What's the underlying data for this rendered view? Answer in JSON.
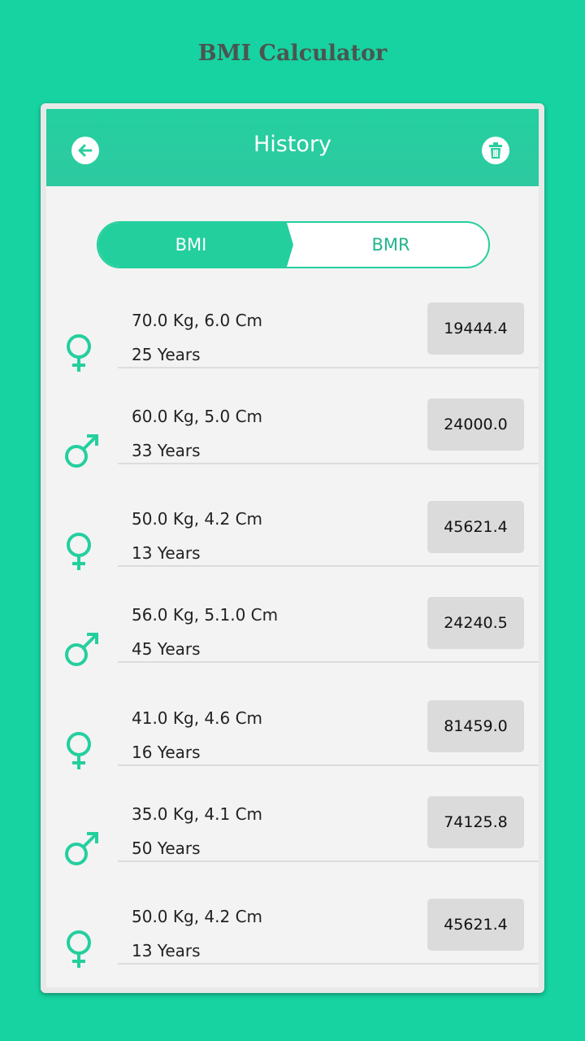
{
  "app_title": "BMI Calculator",
  "header": {
    "title": "History",
    "back_icon": "arrow-left-icon",
    "delete_icon": "trash-icon"
  },
  "tabs": {
    "bmi_label": "BMI",
    "bmr_label": "BMR",
    "selected": "BMI"
  },
  "colors": {
    "accent": "#24cf9e",
    "background": "#17d3a1"
  },
  "history": [
    {
      "gender": "female",
      "measurements": "70.0 Kg, 6.0 Cm",
      "age": "25 Years",
      "value": "19444.4"
    },
    {
      "gender": "male",
      "measurements": "60.0 Kg, 5.0 Cm",
      "age": "33 Years",
      "value": "24000.0"
    },
    {
      "gender": "female",
      "measurements": "50.0 Kg, 4.2 Cm",
      "age": "13 Years",
      "value": "45621.4"
    },
    {
      "gender": "male",
      "measurements": "56.0 Kg, 5.1.0 Cm",
      "age": "45 Years",
      "value": "24240.5"
    },
    {
      "gender": "female",
      "measurements": "41.0 Kg, 4.6 Cm",
      "age": "16 Years",
      "value": "81459.0"
    },
    {
      "gender": "male",
      "measurements": "35.0 Kg, 4.1 Cm",
      "age": "50 Years",
      "value": "74125.8"
    },
    {
      "gender": "female",
      "measurements": "50.0 Kg, 4.2 Cm",
      "age": "13 Years",
      "value": "45621.4"
    }
  ]
}
